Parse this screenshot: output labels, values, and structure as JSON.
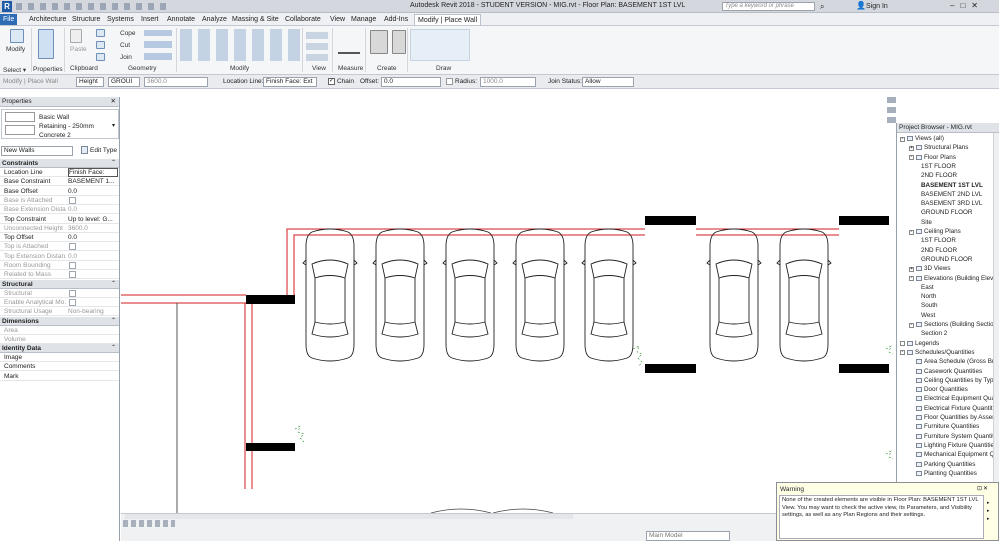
{
  "app": {
    "title": "Autodesk Revit 2018 - STUDENT VERSION -    MIG.rvt - Floor Plan: BASEMENT 1ST LVL",
    "search_placeholder": "Type a keyword or phrase",
    "sign_in": "Sign In"
  },
  "tabs": [
    "File",
    "Architecture",
    "Structure",
    "Systems",
    "Insert",
    "Annotate",
    "Analyze",
    "Massing & Site",
    "Collaborate",
    "View",
    "Manage",
    "Add-Ins",
    "Modify | Place Wall"
  ],
  "ribbon": {
    "modify": "Modify",
    "select": "Select ▾",
    "properties": "Properties",
    "paste": "Paste",
    "cope": "Cope",
    "cut": "Cut",
    "join": "Join",
    "clipboard": "Clipboard",
    "geometry": "Geometry",
    "modify_panel": "Modify",
    "view": "View",
    "measure": "Measure",
    "create": "Create",
    "draw": "Draw"
  },
  "options": {
    "context": "Modify | Place Wall",
    "height_mode": "Height",
    "level": "GROUI",
    "height_value": "3600.0",
    "location_line_label": "Location Line:",
    "location_line": "Finish Face: Ext",
    "chain": "Chain",
    "offset_label": "Offset:",
    "offset": "0.0",
    "radius": "Radius:",
    "radius_value": "1000.0",
    "join_status_label": "Join Status:",
    "join_status": "Allow"
  },
  "properties": {
    "title": "Properties",
    "type_family": "Basic Wall",
    "type_name": "Retaining - 250mm",
    "type_sub": "Concrete 2",
    "instance": "New Walls",
    "edit_type": "Edit Type",
    "sections": [
      {
        "name": "Constraints",
        "rows": [
          {
            "k": "Location Line",
            "v": "Finish Face:",
            "dis": false
          },
          {
            "k": "Base Constraint",
            "v": "BASEMENT 1...",
            "dis": false
          },
          {
            "k": "Base Offset",
            "v": "0.0",
            "dis": false
          },
          {
            "k": "Base is Attached",
            "v": "",
            "cb": true,
            "dis": true
          },
          {
            "k": "Base Extension Dista...",
            "v": "0.0",
            "dis": true
          },
          {
            "k": "Top Constraint",
            "v": "Up to level: G...",
            "dis": false
          },
          {
            "k": "Unconnected Height",
            "v": "3600.0",
            "dis": true
          },
          {
            "k": "Top Offset",
            "v": "0.0",
            "dis": false
          },
          {
            "k": "Top is Attached",
            "v": "",
            "cb": true,
            "dis": true
          },
          {
            "k": "Top Extension Distan...",
            "v": "0.0",
            "dis": true
          },
          {
            "k": "Room Bounding",
            "v": "",
            "cb": true,
            "dis": true
          },
          {
            "k": "Related to Mass",
            "v": "",
            "cb": true,
            "dis": true
          }
        ]
      },
      {
        "name": "Structural",
        "rows": [
          {
            "k": "Structural",
            "v": "",
            "cb": true,
            "dis": true
          },
          {
            "k": "Enable Analytical Mo...",
            "v": "",
            "cb": true,
            "dis": true
          },
          {
            "k": "Structural Usage",
            "v": "Non-bearing",
            "dis": true
          }
        ]
      },
      {
        "name": "Dimensions",
        "rows": [
          {
            "k": "Area",
            "v": "",
            "dis": true
          },
          {
            "k": "Volume",
            "v": "",
            "dis": true
          }
        ]
      },
      {
        "name": "Identity Data",
        "rows": [
          {
            "k": "Image",
            "v": "",
            "dis": false
          },
          {
            "k": "Comments",
            "v": "",
            "dis": false
          },
          {
            "k": "Mark",
            "v": "",
            "dis": false
          }
        ]
      }
    ]
  },
  "browser": {
    "title": "Project Browser - MIG.rvt",
    "nodes": [
      {
        "t": "Views (all)",
        "lvl": 0,
        "tw": "-"
      },
      {
        "t": "Structural Plans",
        "lvl": 1,
        "tw": "+"
      },
      {
        "t": "Floor Plans",
        "lvl": 1,
        "tw": "-"
      },
      {
        "t": "1ST FLOOR",
        "lvl": 2
      },
      {
        "t": "2ND FLOOR",
        "lvl": 2
      },
      {
        "t": "BASEMENT 1ST LVL",
        "lvl": 2,
        "sel": true
      },
      {
        "t": "BASEMENT 2ND LVL",
        "lvl": 2
      },
      {
        "t": "BASEMENT 3RD LVL",
        "lvl": 2
      },
      {
        "t": "GROUND FLOOR",
        "lvl": 2
      },
      {
        "t": "Site",
        "lvl": 2
      },
      {
        "t": "Ceiling Plans",
        "lvl": 1,
        "tw": "-"
      },
      {
        "t": "1ST FLOOR",
        "lvl": 2
      },
      {
        "t": "2ND FLOOR",
        "lvl": 2
      },
      {
        "t": "GROUND FLOOR",
        "lvl": 2
      },
      {
        "t": "3D Views",
        "lvl": 1,
        "tw": "+"
      },
      {
        "t": "Elevations (Building Elevation)",
        "lvl": 1,
        "tw": "-"
      },
      {
        "t": "East",
        "lvl": 2
      },
      {
        "t": "North",
        "lvl": 2
      },
      {
        "t": "South",
        "lvl": 2
      },
      {
        "t": "West",
        "lvl": 2
      },
      {
        "t": "Sections (Building Section)",
        "lvl": 1,
        "tw": "-"
      },
      {
        "t": "Section 2",
        "lvl": 2
      },
      {
        "t": "Legends",
        "lvl": 0,
        "tw": ""
      },
      {
        "t": "Schedules/Quantities",
        "lvl": 0,
        "tw": "-"
      },
      {
        "t": "Area Schedule (Gross Building)",
        "lvl": 1
      },
      {
        "t": "Casework Quantities",
        "lvl": 1
      },
      {
        "t": "Ceiling Quantities by Type",
        "lvl": 1
      },
      {
        "t": "Door Quantities",
        "lvl": 1
      },
      {
        "t": "Electrical Equipment Quantities",
        "lvl": 1
      },
      {
        "t": "Electrical Fixture Quantities",
        "lvl": 1
      },
      {
        "t": "Floor Quantities by Assembly",
        "lvl": 1
      },
      {
        "t": "Furniture Quantities",
        "lvl": 1
      },
      {
        "t": "Furniture System Quantities",
        "lvl": 1
      },
      {
        "t": "Lighting Fixture Quantities",
        "lvl": 1
      },
      {
        "t": "Mechanical Equipment Quantities",
        "lvl": 1
      },
      {
        "t": "Parking Quantities",
        "lvl": 1
      },
      {
        "t": "Planting Quantities",
        "lvl": 1
      }
    ]
  },
  "warning": {
    "title": "Warning",
    "message": "None of the created elements are visible in Floor Plan: BASEMENT 1ST LVL View. You may want to check the active view, its Parameters, and Visibility settings, as well as any Plan Regions and their settings."
  },
  "status": {
    "model": "Main Model"
  }
}
